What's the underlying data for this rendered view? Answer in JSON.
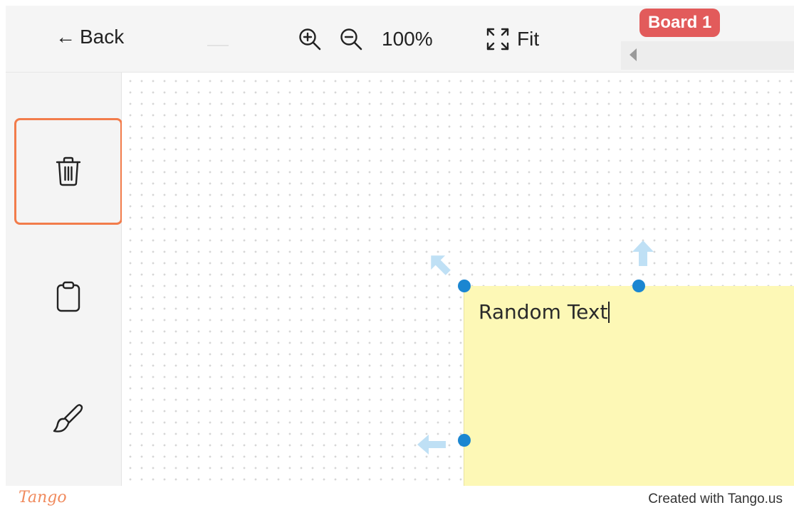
{
  "topbar": {
    "back_arrow": "←",
    "back_label": "Back",
    "zoom_in_icon": "zoom-in-icon",
    "zoom_out_icon": "zoom-out-icon",
    "zoom_level": "100%",
    "fit_label": "Fit",
    "board_badge": "Board 1",
    "badge_color": "#e25b5b"
  },
  "sidebar": {
    "tools": [
      {
        "icon": "trash-icon",
        "selected": true
      },
      {
        "icon": "clipboard-icon",
        "selected": false
      },
      {
        "icon": "paintbrush-icon",
        "selected": false
      }
    ],
    "selection_color": "#f27c4b"
  },
  "canvas": {
    "note": {
      "text": "Random Text",
      "color": "#fdf8b6"
    },
    "handle_color": "#1b86d1"
  },
  "footer": {
    "logo": "Tango",
    "credit": "Created with Tango.us"
  }
}
